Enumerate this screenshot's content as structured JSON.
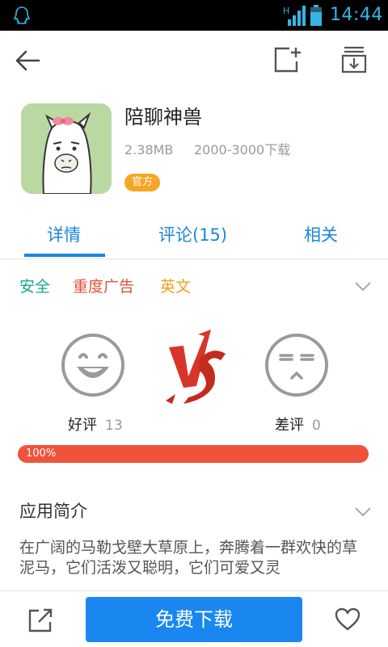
{
  "status_bar": {
    "time": "14:44",
    "network": "H"
  },
  "app": {
    "name": "陪聊神兽",
    "size": "2.38MB",
    "downloads": "2000-3000下载",
    "badge": "官方"
  },
  "tabs": [
    {
      "label": "详情",
      "active": true
    },
    {
      "label": "评论(15)",
      "active": false
    },
    {
      "label": "相关",
      "active": false
    }
  ],
  "tags": [
    {
      "label": "安全",
      "color": "#1aa58a"
    },
    {
      "label": "重度广告",
      "color": "#e0533a"
    },
    {
      "label": "英文",
      "color": "#f0a020"
    }
  ],
  "rating": {
    "good_label": "好评",
    "good_count": "13",
    "bad_label": "差评",
    "bad_count": "0",
    "percent_label": "100%",
    "percent": 100
  },
  "intro": {
    "title": "应用简介",
    "text": "在广阔的马勒戈壁大草原上，奔腾着一群欢快的草泥马，它们活泼又聪明，它们可爱又灵"
  },
  "bottom": {
    "download_label": "免费下载"
  },
  "colors": {
    "accent": "#1a87f0",
    "bar": "#f0533a",
    "badge": "#f5a623"
  }
}
